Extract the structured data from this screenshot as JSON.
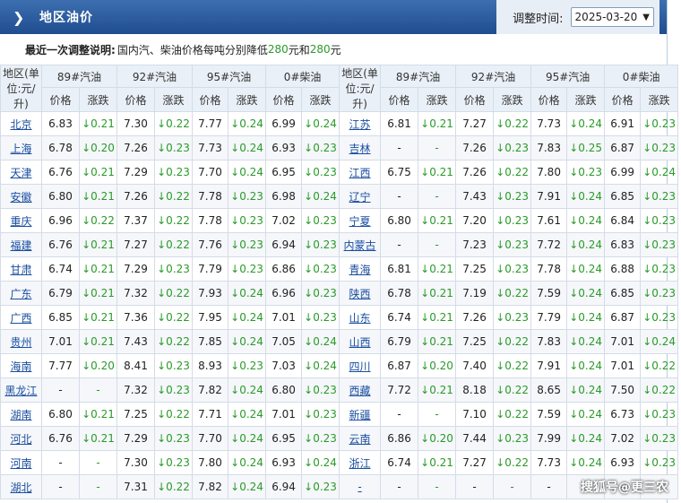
{
  "header": {
    "title": "地区油价",
    "adjust_label": "调整时间:",
    "adjust_date": "2025-03-20"
  },
  "notice": {
    "label": "最近一次调整说明:",
    "text_before": "国内汽、柴油价格每吨分别降低",
    "v1": "280",
    "mid": "元和",
    "v2": "280",
    "text_after": "元"
  },
  "colors": {
    "header_bg": "#2d5fa0",
    "down_green": "#2a9a2a",
    "region_link": "#1a4ea0"
  },
  "table": {
    "region_header": "地区(单位:元/升)",
    "fuels": [
      "89#汽油",
      "92#汽油",
      "95#汽油",
      "0#柴油"
    ],
    "sub": [
      "价格",
      "涨跌"
    ],
    "rows": [
      [
        [
          "北京",
          "6.83",
          "↓0.21",
          "7.30",
          "↓0.22",
          "7.77",
          "↓0.24",
          "6.99",
          "↓0.24"
        ],
        [
          "江苏",
          "6.81",
          "↓0.21",
          "7.27",
          "↓0.22",
          "7.73",
          "↓0.24",
          "6.91",
          "↓0.23"
        ]
      ],
      [
        [
          "上海",
          "6.78",
          "↓0.20",
          "7.26",
          "↓0.23",
          "7.73",
          "↓0.24",
          "6.93",
          "↓0.23"
        ],
        [
          "吉林",
          "-",
          "-",
          "7.26",
          "↓0.23",
          "7.83",
          "↓0.25",
          "6.87",
          "↓0.23"
        ]
      ],
      [
        [
          "天津",
          "6.76",
          "↓0.21",
          "7.29",
          "↓0.23",
          "7.70",
          "↓0.24",
          "6.95",
          "↓0.23"
        ],
        [
          "江西",
          "6.75",
          "↓0.21",
          "7.26",
          "↓0.22",
          "7.80",
          "↓0.23",
          "6.99",
          "↓0.24"
        ]
      ],
      [
        [
          "安徽",
          "6.80",
          "↓0.21",
          "7.26",
          "↓0.22",
          "7.78",
          "↓0.23",
          "6.98",
          "↓0.24"
        ],
        [
          "辽宁",
          "-",
          "-",
          "7.43",
          "↓0.23",
          "7.91",
          "↓0.24",
          "6.85",
          "↓0.23"
        ]
      ],
      [
        [
          "重庆",
          "6.96",
          "↓0.22",
          "7.37",
          "↓0.22",
          "7.78",
          "↓0.23",
          "7.02",
          "↓0.23"
        ],
        [
          "宁夏",
          "6.80",
          "↓0.21",
          "7.20",
          "↓0.23",
          "7.61",
          "↓0.24",
          "6.84",
          "↓0.23"
        ]
      ],
      [
        [
          "福建",
          "6.76",
          "↓0.21",
          "7.27",
          "↓0.22",
          "7.76",
          "↓0.23",
          "6.94",
          "↓0.23"
        ],
        [
          "内蒙古",
          "-",
          "-",
          "7.23",
          "↓0.23",
          "7.72",
          "↓0.24",
          "6.83",
          "↓0.23"
        ]
      ],
      [
        [
          "甘肃",
          "6.74",
          "↓0.21",
          "7.29",
          "↓0.23",
          "7.79",
          "↓0.23",
          "6.86",
          "↓0.23"
        ],
        [
          "青海",
          "6.81",
          "↓0.21",
          "7.25",
          "↓0.23",
          "7.78",
          "↓0.24",
          "6.88",
          "↓0.23"
        ]
      ],
      [
        [
          "广东",
          "6.79",
          "↓0.21",
          "7.32",
          "↓0.22",
          "7.93",
          "↓0.24",
          "6.96",
          "↓0.23"
        ],
        [
          "陕西",
          "6.78",
          "↓0.21",
          "7.19",
          "↓0.22",
          "7.59",
          "↓0.24",
          "6.85",
          "↓0.23"
        ]
      ],
      [
        [
          "广西",
          "6.85",
          "↓0.21",
          "7.36",
          "↓0.22",
          "7.95",
          "↓0.24",
          "7.01",
          "↓0.23"
        ],
        [
          "山东",
          "6.74",
          "↓0.21",
          "7.26",
          "↓0.23",
          "7.79",
          "↓0.24",
          "6.87",
          "↓0.23"
        ]
      ],
      [
        [
          "贵州",
          "7.01",
          "↓0.21",
          "7.43",
          "↓0.22",
          "7.85",
          "↓0.24",
          "7.05",
          "↓0.24"
        ],
        [
          "山西",
          "6.79",
          "↓0.21",
          "7.25",
          "↓0.22",
          "7.83",
          "↓0.24",
          "7.01",
          "↓0.24"
        ]
      ],
      [
        [
          "海南",
          "7.77",
          "↓0.20",
          "8.41",
          "↓0.23",
          "8.93",
          "↓0.23",
          "7.03",
          "↓0.24"
        ],
        [
          "四川",
          "6.87",
          "↓0.20",
          "7.40",
          "↓0.22",
          "7.91",
          "↓0.24",
          "7.01",
          "↓0.22"
        ]
      ],
      [
        [
          "黑龙江",
          "-",
          "-",
          "7.32",
          "↓0.23",
          "7.82",
          "↓0.24",
          "6.80",
          "↓0.23"
        ],
        [
          "西藏",
          "7.72",
          "↓0.21",
          "8.18",
          "↓0.22",
          "8.65",
          "↓0.24",
          "7.50",
          "↓0.22"
        ]
      ],
      [
        [
          "湖南",
          "6.80",
          "↓0.21",
          "7.25",
          "↓0.22",
          "7.71",
          "↓0.24",
          "7.01",
          "↓0.23"
        ],
        [
          "新疆",
          "-",
          "-",
          "7.10",
          "↓0.22",
          "7.59",
          "↓0.24",
          "6.73",
          "↓0.23"
        ]
      ],
      [
        [
          "河北",
          "6.76",
          "↓0.21",
          "7.29",
          "↓0.23",
          "7.70",
          "↓0.24",
          "6.95",
          "↓0.23"
        ],
        [
          "云南",
          "6.86",
          "↓0.20",
          "7.44",
          "↓0.23",
          "7.99",
          "↓0.24",
          "7.02",
          "↓0.23"
        ]
      ],
      [
        [
          "河南",
          "-",
          "-",
          "7.30",
          "↓0.23",
          "7.80",
          "↓0.24",
          "6.93",
          "↓0.24"
        ],
        [
          "浙江",
          "6.74",
          "↓0.21",
          "7.27",
          "↓0.22",
          "7.73",
          "↓0.24",
          "6.93",
          "↓0.23"
        ]
      ],
      [
        [
          "湖北",
          "-",
          "-",
          "7.31",
          "↓0.22",
          "7.82",
          "↓0.24",
          "6.94",
          "↓0.23"
        ],
        [
          "-",
          "-",
          "-",
          "-",
          "-",
          "-",
          "-",
          "-",
          "-"
        ]
      ]
    ]
  },
  "watermark": "搜狐号@更三农"
}
